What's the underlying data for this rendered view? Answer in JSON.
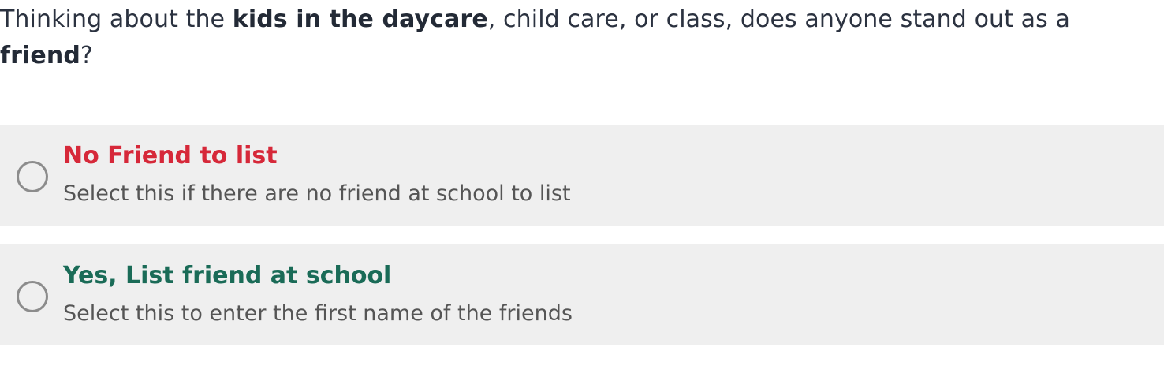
{
  "question": {
    "part1": "Thinking about the ",
    "bold1": "kids in the daycare",
    "part2": ", child care, or class, does anyone stand out as a ",
    "bold2": "friend",
    "part3": "?"
  },
  "options": [
    {
      "title": "No Friend to list",
      "description": "Select this if there are no friend at school to list",
      "title_color": "#d62839"
    },
    {
      "title": "Yes, List friend at school",
      "description": "Select this to enter the first name of the friends",
      "title_color": "#1a6b57"
    }
  ]
}
